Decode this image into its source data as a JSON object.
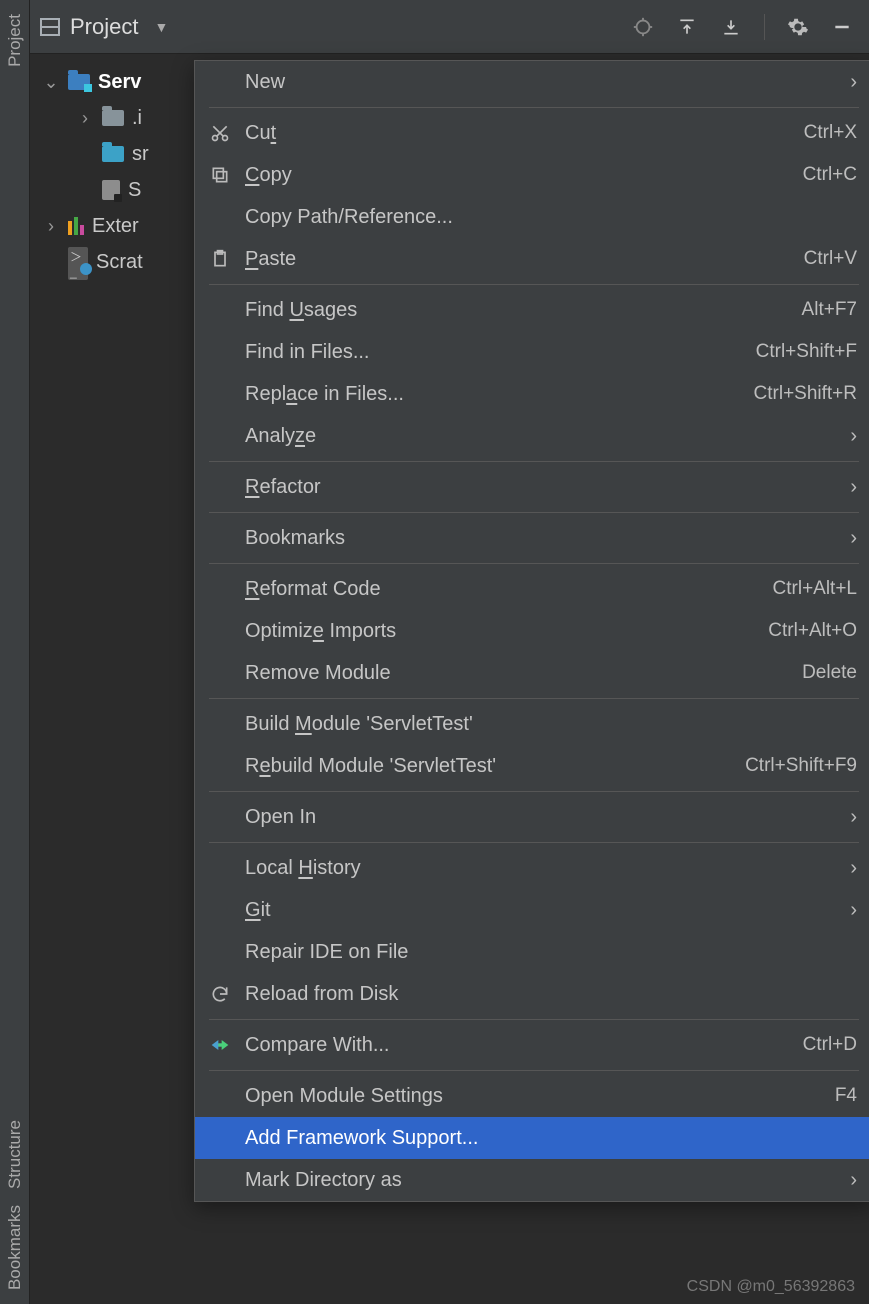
{
  "rail": {
    "project": "Project",
    "structure": "Structure",
    "bookmarks": "Bookmarks"
  },
  "toolbar": {
    "title": "Project"
  },
  "tree": {
    "root": "Serv",
    "items": [
      {
        "chev": "›",
        "iconClass": "folder",
        "label": ".i"
      },
      {
        "chev": "",
        "iconClass": "folder blue",
        "label": "sr"
      },
      {
        "chev": "",
        "iconClass": "file-icon",
        "label": "S"
      }
    ],
    "ext": "Exter",
    "scratch": "Scrat"
  },
  "menu": {
    "items": [
      {
        "type": "item",
        "icon": "",
        "label": "New",
        "shortcut": "",
        "submenu": true
      },
      {
        "type": "sep"
      },
      {
        "type": "item",
        "icon": "cut",
        "label": "Cut",
        "u": 2,
        "shortcut": "Ctrl+X"
      },
      {
        "type": "item",
        "icon": "copy",
        "label": "Copy",
        "u": 0,
        "shortcut": "Ctrl+C"
      },
      {
        "type": "item",
        "icon": "",
        "label": "Copy Path/Reference...",
        "shortcut": ""
      },
      {
        "type": "item",
        "icon": "paste",
        "label": "Paste",
        "u": 0,
        "shortcut": "Ctrl+V"
      },
      {
        "type": "sep"
      },
      {
        "type": "item",
        "icon": "",
        "label": "Find Usages",
        "u": 5,
        "shortcut": "Alt+F7"
      },
      {
        "type": "item",
        "icon": "",
        "label": "Find in Files...",
        "shortcut": "Ctrl+Shift+F"
      },
      {
        "type": "item",
        "icon": "",
        "label": "Replace in Files...",
        "u": 4,
        "shortcut": "Ctrl+Shift+R"
      },
      {
        "type": "item",
        "icon": "",
        "label": "Analyze",
        "u": 5,
        "shortcut": "",
        "submenu": true
      },
      {
        "type": "sep"
      },
      {
        "type": "item",
        "icon": "",
        "label": "Refactor",
        "u": 0,
        "shortcut": "",
        "submenu": true
      },
      {
        "type": "sep"
      },
      {
        "type": "item",
        "icon": "",
        "label": "Bookmarks",
        "shortcut": "",
        "submenu": true
      },
      {
        "type": "sep"
      },
      {
        "type": "item",
        "icon": "",
        "label": "Reformat Code",
        "u": 0,
        "shortcut": "Ctrl+Alt+L"
      },
      {
        "type": "item",
        "icon": "",
        "label": "Optimize Imports",
        "u": 7,
        "shortcut": "Ctrl+Alt+O"
      },
      {
        "type": "item",
        "icon": "",
        "label": "Remove Module",
        "shortcut": "Delete"
      },
      {
        "type": "sep"
      },
      {
        "type": "item",
        "icon": "",
        "label": "Build Module 'ServletTest'",
        "u": 6,
        "shortcut": ""
      },
      {
        "type": "item",
        "icon": "",
        "label": "Rebuild Module 'ServletTest'",
        "u": 1,
        "shortcut": "Ctrl+Shift+F9"
      },
      {
        "type": "sep"
      },
      {
        "type": "item",
        "icon": "",
        "label": "Open In",
        "shortcut": "",
        "submenu": true
      },
      {
        "type": "sep"
      },
      {
        "type": "item",
        "icon": "",
        "label": "Local History",
        "u": 6,
        "shortcut": "",
        "submenu": true
      },
      {
        "type": "item",
        "icon": "",
        "label": "Git",
        "u": 0,
        "shortcut": "",
        "submenu": true
      },
      {
        "type": "item",
        "icon": "",
        "label": "Repair IDE on File",
        "shortcut": ""
      },
      {
        "type": "item",
        "icon": "reload",
        "label": "Reload from Disk",
        "shortcut": ""
      },
      {
        "type": "sep"
      },
      {
        "type": "item",
        "icon": "diff",
        "label": "Compare With...",
        "shortcut": "Ctrl+D"
      },
      {
        "type": "sep"
      },
      {
        "type": "item",
        "icon": "",
        "label": "Open Module Settings",
        "shortcut": "F4"
      },
      {
        "type": "item",
        "icon": "",
        "label": "Add Framework Support...",
        "shortcut": "",
        "selected": true
      },
      {
        "type": "item",
        "icon": "",
        "label": "Mark Directory as",
        "shortcut": "",
        "submenu": true
      }
    ]
  },
  "watermark": "CSDN @m0_56392863"
}
